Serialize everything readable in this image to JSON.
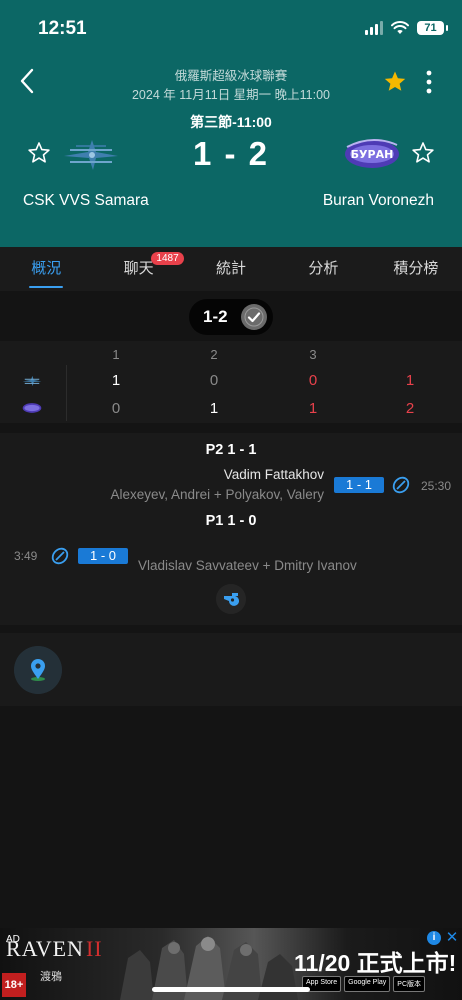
{
  "status_bar": {
    "time": "12:51",
    "battery": "71"
  },
  "header": {
    "league": "俄羅斯超級冰球聯賽",
    "datetime": "2024 年 11月11日  星期一  晚上11:00",
    "period_clock": "第三節-11:00",
    "score": "1 - 2",
    "home_team": "CSK VVS Samara",
    "away_team": "Buran Voronezh",
    "away_logo_text": "БУРАН"
  },
  "tabs": [
    {
      "label": "概況",
      "active": true
    },
    {
      "label": "聊天",
      "badge": "1487"
    },
    {
      "label": "統計"
    },
    {
      "label": "分析"
    },
    {
      "label": "積分榜"
    }
  ],
  "score_pill": "1-2",
  "period_table": {
    "headers": [
      "1",
      "2",
      "3"
    ],
    "home": {
      "p1": "1",
      "p2": "0",
      "p3": "0",
      "total": "1"
    },
    "away": {
      "p1": "0",
      "p2": "1",
      "p3": "1",
      "total": "2"
    }
  },
  "events": {
    "p2": {
      "header": "P2  1 - 1",
      "scorer": "Vadim Fattakhov",
      "assists": "Alexeyev, Andrei + Polyakov, Valery",
      "score": "1 - 1",
      "time": "25:30"
    },
    "p1": {
      "header": "P1  1 - 0",
      "scorer": "Vladislav Savvateev + Dmitry Ivanov",
      "score": "1 - 0",
      "time": "3:49"
    }
  },
  "ad": {
    "label": "AD",
    "brand": "RAVEN",
    "brand_numeral": "II",
    "brand_sub": "渡鴉",
    "rating": "18+",
    "headline": "11/20 正式上市!",
    "store_1": "App Store",
    "store_2": "Google Play",
    "store_3": "PC版本"
  },
  "colors": {
    "header_bg": "#0c6765",
    "accent_blue": "#3a9ff0",
    "badge_red": "#e8414b",
    "star_gold": "#f5b800"
  }
}
